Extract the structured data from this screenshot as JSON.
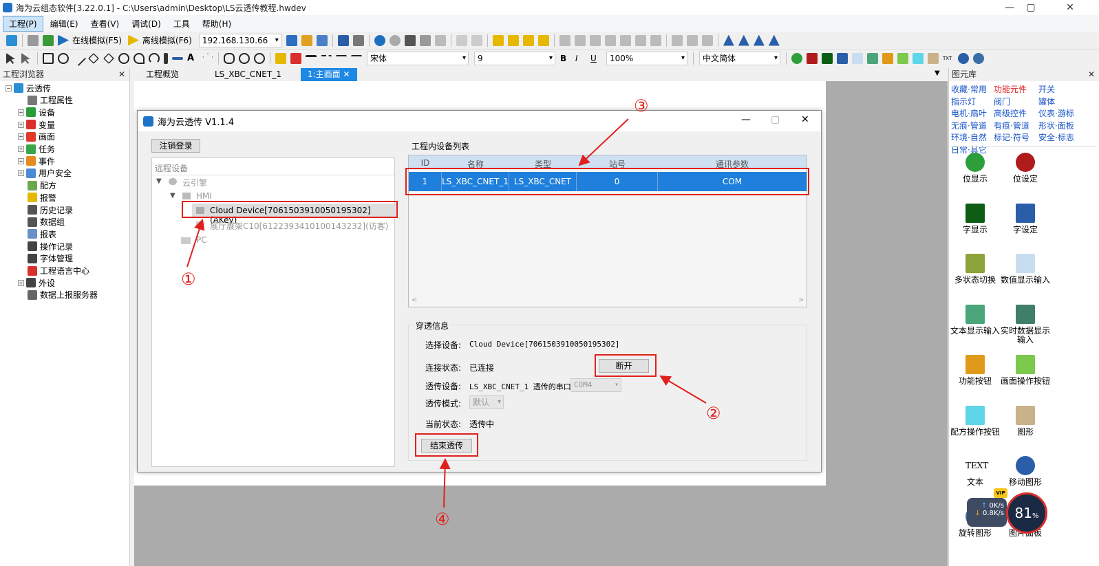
{
  "titlebar": {
    "title": "海为云组态软件[3.22.0.1] - C:\\Users\\admin\\Desktop\\LS云透传教程.hwdev",
    "min": "—",
    "max": "▢",
    "close": "✕"
  },
  "menu": [
    "工程(P)",
    "编辑(E)",
    "查看(V)",
    "调试(D)",
    "工具",
    "帮助(H)"
  ],
  "toolbar1": {
    "online": "在线模拟(F5)",
    "offline": "离线模拟(F6)",
    "ip": "192.168.130.66"
  },
  "toolbar2": {
    "font": "宋体",
    "size": "9",
    "zoom": "100%",
    "lang": "中文简体"
  },
  "left_panel": {
    "title": "工程浏览器",
    "items": [
      {
        "label": "云透传",
        "color": "#2b8fd6"
      },
      {
        "label": "工程属性",
        "color": "#777777"
      },
      {
        "label": "设备",
        "color": "#2a9d3a"
      },
      {
        "label": "变量",
        "color": "#d9302c"
      },
      {
        "label": "画面",
        "color": "#e03a2a"
      },
      {
        "label": "任务",
        "color": "#3aa64a"
      },
      {
        "label": "事件",
        "color": "#e58a1f"
      },
      {
        "label": "用户安全",
        "color": "#4a8ad6"
      },
      {
        "label": "配方",
        "color": "#6aa84f"
      },
      {
        "label": "报警",
        "color": "#e6b800"
      },
      {
        "label": "历史记录",
        "color": "#555555"
      },
      {
        "label": "数据组",
        "color": "#555555"
      },
      {
        "label": "报表",
        "color": "#6b8fc7"
      },
      {
        "label": "操作记录",
        "color": "#444444"
      },
      {
        "label": "字体管理",
        "color": "#444444"
      },
      {
        "label": "工程语言中心",
        "color": "#d9302c"
      },
      {
        "label": "外设",
        "color": "#444444"
      },
      {
        "label": "数据上报服务器",
        "color": "#666666"
      }
    ]
  },
  "tabs": [
    "工程概览",
    "LS_XBC_CNET_1",
    "1:主画面"
  ],
  "right_panel": {
    "title": "图元库",
    "categories": [
      "收藏·常用",
      "功能元件",
      "开关",
      "指示灯",
      "阀门",
      "罐体",
      "电机·扇叶",
      "高级控件",
      "仪表·游标",
      "无痕·管道",
      "有痕·管道",
      "形状·面板",
      "环境·自然",
      "标记·符号",
      "安全·标志",
      "日常·其它"
    ],
    "items": [
      {
        "label": "位显示",
        "color": "#2e9e3a"
      },
      {
        "label": "位设定",
        "color": "#b01c1c"
      },
      {
        "label": "字显示",
        "color": "#0d5e14"
      },
      {
        "label": "字设定",
        "color": "#2a5ea8"
      },
      {
        "label": "多状态切换",
        "color": "#8ca33a"
      },
      {
        "label": "数值显示输入",
        "color": "#c9ddf0"
      },
      {
        "label": "文本显示输入",
        "color": "#4aa67a"
      },
      {
        "label": "实时数据显示输入",
        "color": "#3f7f6a"
      },
      {
        "label": "功能按钮",
        "color": "#e09a1a"
      },
      {
        "label": "画面操作按钮",
        "color": "#7cc94e"
      },
      {
        "label": "配方操作按钮",
        "color": "#5fd6e8"
      },
      {
        "label": "图形",
        "color": "#c9b28a"
      },
      {
        "label": "文本",
        "color": "#ffffff"
      },
      {
        "label": "移动图形",
        "color": "#2a5ea8"
      },
      {
        "label": "旋转图形",
        "color": "#3a6ea8"
      },
      {
        "label": "图片面板",
        "color": "#555555"
      }
    ],
    "text_icon": "TEXT"
  },
  "net": {
    "up": "0K/s",
    "down": "0.8K/s",
    "percent": "81",
    "unit": "%",
    "vip": "VIP"
  },
  "dialog": {
    "title": "海为云透传 V1.1.4",
    "logout": "注销登录",
    "remote_label": "远程设备",
    "tree": [
      "云引擎",
      "HMI",
      "Cloud Device[7061503910050195302](AKey)",
      "展厅展架C10[6122393410100143232](访客)",
      "PC"
    ],
    "list_title": "工程内设备列表",
    "columns": [
      "ID",
      "名称",
      "类型",
      "站号",
      "通讯参数"
    ],
    "row": [
      "1",
      "LS_XBC_CNET_1",
      "LS_XBC_CNET",
      "0",
      "COM"
    ],
    "passthru": {
      "title": "穿透信息",
      "select_label": "选择设备:",
      "select_value": "Cloud Device[7061503910050195302]",
      "conn_label": "连接状态:",
      "conn_value": "已连接",
      "disconnect": "断开",
      "dev_label": "透传设备:",
      "dev_value": "LS_XBC_CNET_1 透传的串口",
      "port": "COM4",
      "mode_label": "透传模式:",
      "mode_value": "默认",
      "state_label": "当前状态:",
      "state_value": "透传中",
      "end": "结束透传"
    }
  },
  "annotations": [
    "①",
    "②",
    "③",
    "④"
  ]
}
